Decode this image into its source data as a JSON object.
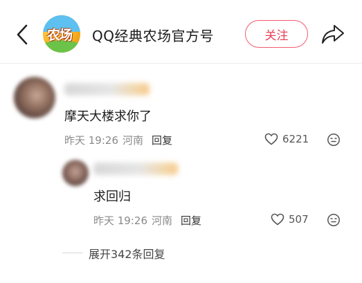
{
  "header": {
    "account_name": "QQ经典农场官方号",
    "logo_text": "农场",
    "follow_label": "关注"
  },
  "comments": [
    {
      "text": "摩天大楼求你了",
      "time": "昨天 19:26",
      "location": "河南",
      "reply_label": "回复",
      "likes": "6221"
    },
    {
      "text": "求回归",
      "time": "昨天 19:26",
      "location": "河南",
      "reply_label": "回复",
      "likes": "507"
    }
  ],
  "expand_replies_label": "展开342条回复",
  "colors": {
    "accent": "#e94057",
    "meta": "#8a8a8a"
  },
  "icons": [
    "back-arrow-icon",
    "share-icon",
    "heart-icon",
    "emoji-icon"
  ]
}
